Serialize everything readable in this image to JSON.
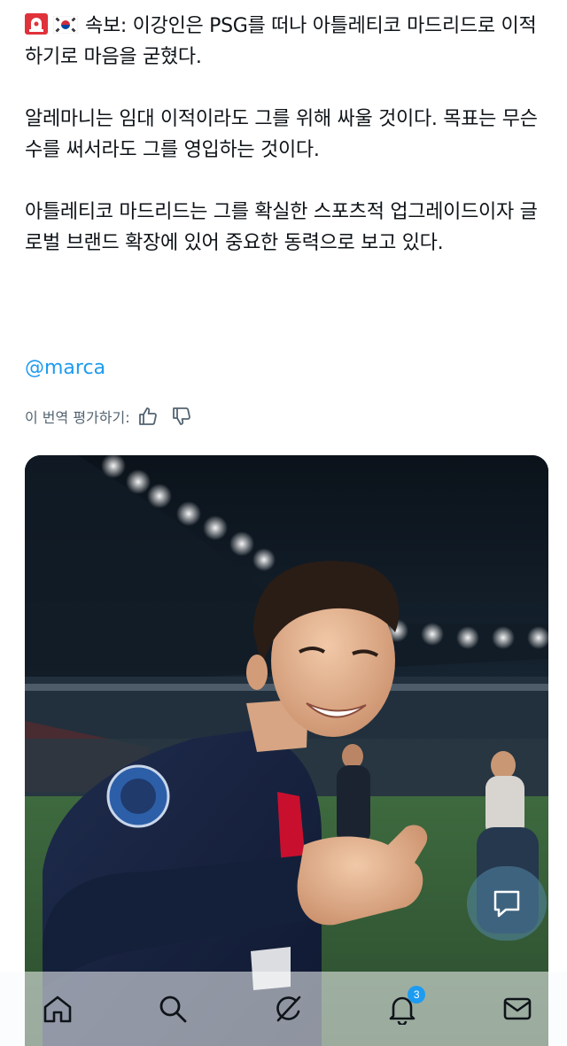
{
  "post": {
    "paragraph_1": "속보: 이강인은 PSG를 떠나 아틀레티코 마드리드로 이적하기로 마음을 굳혔다.",
    "paragraph_2": "알레마니는 임대 이적이라도 그를 위해 싸울 것이다. 목표는 무슨 수를 써서라도 그를 영입하는 것이다.",
    "paragraph_3": "아틀레티코 마드리드는 그를 확실한 스포츠적 업그레이드이자 글로벌 브랜드 확장에 있어 중요한 동력으로 보고 있다.",
    "emojis": [
      "siren-emoji",
      "south-korea-flag-emoji"
    ],
    "handle": "@marca"
  },
  "translation_rating": {
    "label": "이 번역 평가하기:",
    "icons": [
      "thumbs-up-icon",
      "thumbs-down-icon"
    ]
  },
  "media": {
    "icons": [
      "photo-of-player"
    ]
  },
  "fab": {
    "icon": "compose-icon"
  },
  "bottom_nav": {
    "items": [
      {
        "icon": "home-icon"
      },
      {
        "icon": "search-icon"
      },
      {
        "icon": "grok-icon"
      },
      {
        "icon": "notifications-icon",
        "badge": "3"
      },
      {
        "icon": "messages-icon"
      }
    ]
  },
  "colors": {
    "link": "#1d9bf0",
    "text": "#0f1419",
    "muted": "#536471",
    "badge": "#1d9bf0"
  }
}
